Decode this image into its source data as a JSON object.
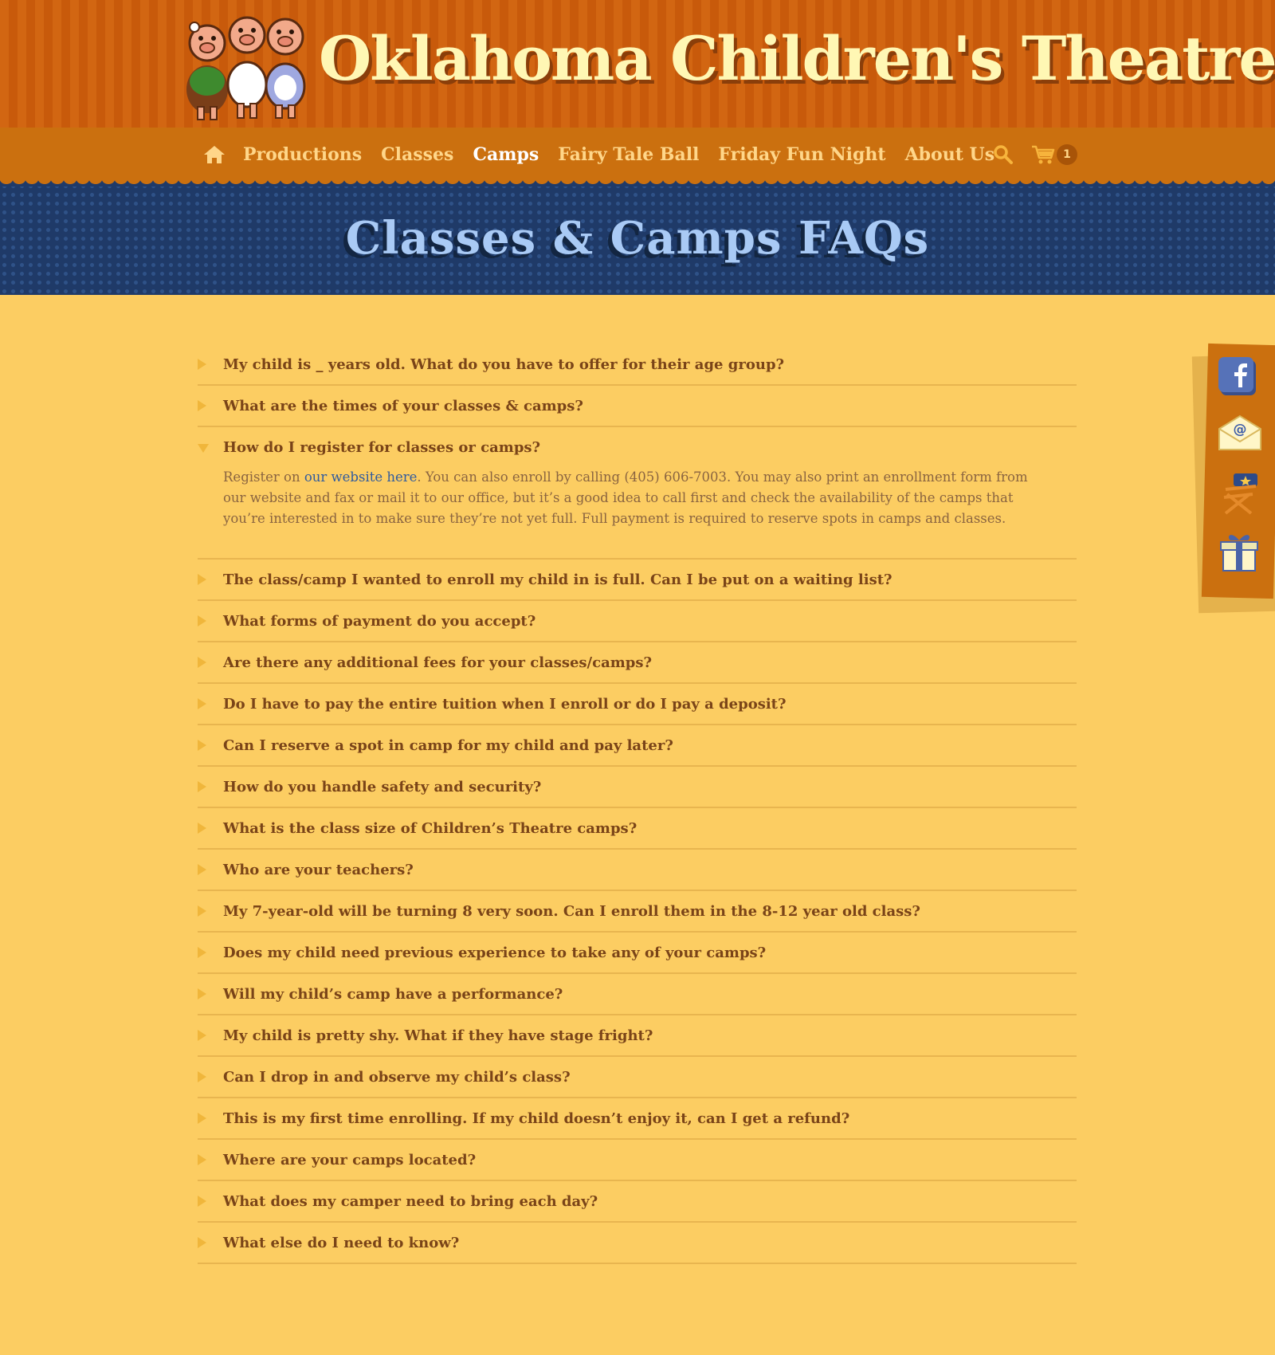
{
  "site": {
    "logo_text": "Oklahoma Children's Theatre"
  },
  "nav": {
    "items": [
      {
        "label": "Productions",
        "active": false
      },
      {
        "label": "Classes",
        "active": false
      },
      {
        "label": "Camps",
        "active": true
      },
      {
        "label": "Fairy Tale Ball",
        "active": false
      },
      {
        "label": "Friday Fun Night",
        "active": false
      },
      {
        "label": "About Us",
        "active": false
      }
    ],
    "cart_count": "1",
    "icons": [
      "home-icon",
      "search-icon",
      "cart-icon"
    ]
  },
  "banner": {
    "title": "Classes & Camps FAQs"
  },
  "faq": {
    "items": [
      {
        "q": "My child is _ years old. What do you have to offer for their age group?"
      },
      {
        "q": "What are the times of your classes & camps?"
      },
      {
        "q": "How do I register for classes or camps?",
        "open": true,
        "answer_prefix": "Register on ",
        "answer_link": "our website here",
        "answer_rest": ". You can also enroll by calling (405) 606-7003. You may also print an enrollment form from our website and fax or mail it to our office, but it’s a good idea to call first and check the availability of the camps that you’re interested in to make sure they’re not yet full. Full payment is required to reserve spots in camps and classes."
      },
      {
        "q": "The class/camp I wanted to enroll my child in is full. Can I be put on a waiting list?"
      },
      {
        "q": "What forms of payment do you accept?"
      },
      {
        "q": "Are there any additional fees for your classes/camps?"
      },
      {
        "q": "Do I have to pay the entire tuition when I enroll or do I pay a deposit?"
      },
      {
        "q": "Can I reserve a spot in camp for my child and pay later?"
      },
      {
        "q": "How do you handle safety and security?"
      },
      {
        "q": "What is the class size of Children’s Theatre camps?"
      },
      {
        "q": "Who are your teachers?"
      },
      {
        "q": "My 7-year-old will be turning 8 very soon. Can I enroll them in the 8-12 year old class?"
      },
      {
        "q": "Does my child need previous experience to take any of your camps?"
      },
      {
        "q": "Will my child’s camp have a performance?"
      },
      {
        "q": "My child is pretty shy. What if they have stage fright?"
      },
      {
        "q": "Can I drop in and observe my child’s class?"
      },
      {
        "q": "This is my first time enrolling. If my child doesn’t enjoy it, can I get a refund?"
      },
      {
        "q": "Where are your camps located?"
      },
      {
        "q": "What does my camper need to bring each day?"
      },
      {
        "q": "What else do I need to know?"
      }
    ]
  },
  "sidebar": {
    "icons": [
      "facebook-icon",
      "email-icon",
      "director-chair-icon",
      "gift-icon"
    ]
  },
  "colors": {
    "page_bg": "#FCCD62",
    "header_orange": "#CB700F",
    "banner_navy": "#1F3A68",
    "banner_title": "#A9CAF5",
    "question_text": "#7A4418",
    "answer_text": "#8A6440",
    "link": "#2F5A9E",
    "arrow": "#F0B63B"
  }
}
